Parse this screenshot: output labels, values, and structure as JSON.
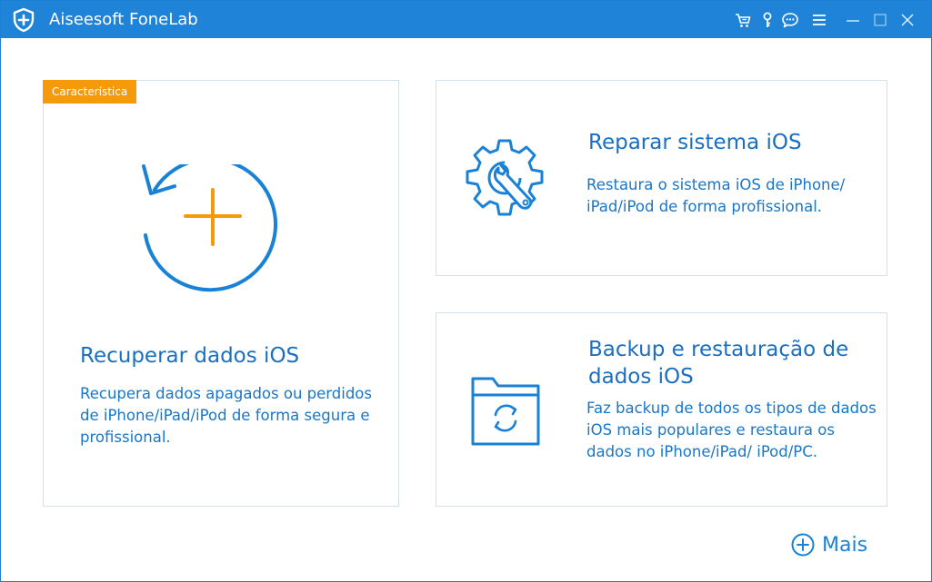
{
  "window": {
    "title": "Aiseesoft FoneLab",
    "icons": [
      "shield-plus-icon",
      "cart-icon",
      "key-icon",
      "chat-icon",
      "menu-icon",
      "minimize-icon",
      "maximize-icon",
      "close-icon"
    ]
  },
  "cards": {
    "recover": {
      "badge": "Característica",
      "title": "Recuperar dados iOS",
      "description": "Recupera dados apagados ou perdidos de iPhone/iPad/iPod de forma segura e profissional.",
      "icon": "restore-plus-icon"
    },
    "repair": {
      "title": "Reparar sistema iOS",
      "description": "Restaura o sistema iOS de iPhone/ iPad/iPod de forma profissional.",
      "icon": "gear-wrench-icon"
    },
    "backup": {
      "title": "Backup e restauração de dados iOS",
      "description": "Faz backup de todos os tipos de dados iOS mais populares e restaura os dados no iPhone/iPad/ iPod/PC.",
      "icon": "folder-sync-icon"
    }
  },
  "more": {
    "label": "Mais",
    "icon": "circle-plus-icon"
  },
  "colors": {
    "titlebar": "#1f83d7",
    "accent": "#1a82d6",
    "badge": "#f59a0b",
    "plus": "#f59a0b",
    "card_border": "#cfe0ef"
  }
}
